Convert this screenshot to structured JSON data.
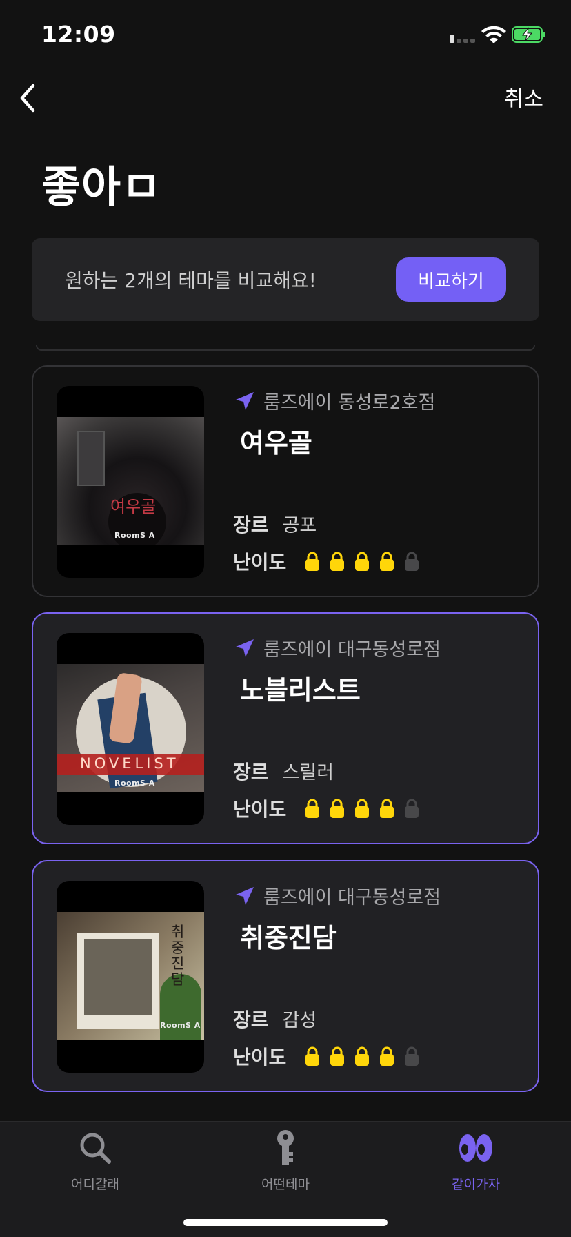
{
  "status_bar": {
    "time": "12:09",
    "battery_color": "#4cd964"
  },
  "nav": {
    "cancel_label": "취소"
  },
  "page": {
    "title": "좋아ㅁ"
  },
  "compare": {
    "text": "원하는 2개의 테마를 비교해요!",
    "button_label": "비교하기"
  },
  "labels": {
    "genre": "장르",
    "difficulty": "난이도"
  },
  "themes": [
    {
      "location": "룸즈에이 동성로2호점",
      "title": "여우골",
      "genre": "공포",
      "difficulty": 4,
      "difficulty_max": 5,
      "selected": false,
      "poster_title": "여우골",
      "poster_brand": "RoomS A"
    },
    {
      "location": "룸즈에이 대구동성로점",
      "title": "노블리스트",
      "genre": "스릴러",
      "difficulty": 4,
      "difficulty_max": 5,
      "selected": true,
      "poster_title": "NOVELIST",
      "poster_brand": "RoomS A"
    },
    {
      "location": "룸즈에이 대구동성로점",
      "title": "취중진담",
      "genre": "감성",
      "difficulty": 4,
      "difficulty_max": 5,
      "selected": true,
      "poster_title": "취중진담",
      "poster_brand": "RoomS A"
    }
  ],
  "tabs": [
    {
      "label": "어디갈래",
      "icon": "search-icon",
      "active": false
    },
    {
      "label": "어떤테마",
      "icon": "key-icon",
      "active": false
    },
    {
      "label": "같이가자",
      "icon": "eyes-icon",
      "active": true
    }
  ],
  "colors": {
    "accent": "#7a63f0",
    "lock_on": "#ffd60a",
    "lock_off": "#48484a",
    "background": "#121212"
  }
}
